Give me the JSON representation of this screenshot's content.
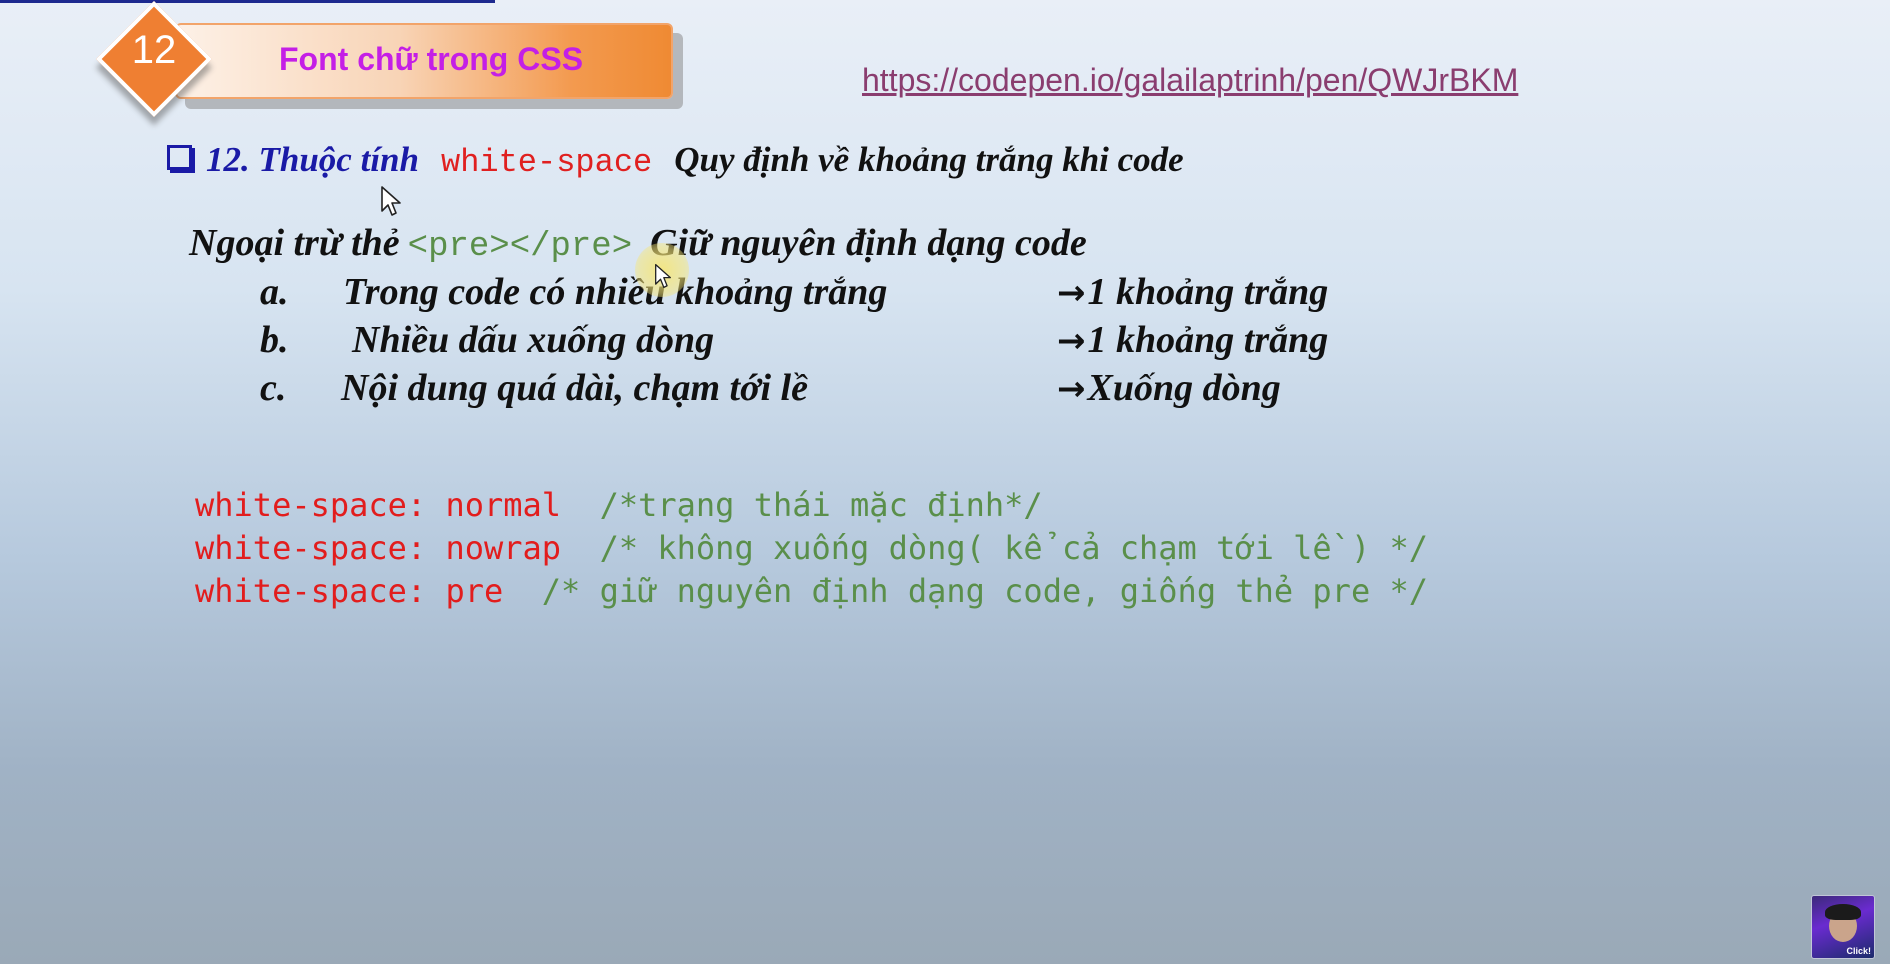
{
  "slide": {
    "badge_number": "12",
    "title": "Font chữ trong CSS",
    "link": "https://codepen.io/galailaptrinh/pen/QWJrBKM"
  },
  "heading": {
    "prefix": "12. Thuộc tính",
    "property": "white-space",
    "description": "Quy định về khoảng trắng khi code"
  },
  "exception": {
    "prefix": "Ngoại trừ thẻ",
    "tag": "<pre></pre>",
    "suffix": "Giữ nguyên định dạng code"
  },
  "rules": [
    {
      "letter": "a.",
      "text": "Trong code có nhiều khoảng trắng",
      "result": "1 khoảng trắng"
    },
    {
      "letter": "b.",
      "text": "Nhiều dấu xuống dòng",
      "result": "1 khoảng trắng"
    },
    {
      "letter": "c.",
      "text": "Nội dung quá dài, chạm tới lề",
      "result": "Xuống dòng"
    }
  ],
  "code_lines": [
    {
      "code": "white-space: normal",
      "comment": "  /*trạng thái mặc định*/"
    },
    {
      "code": "white-space: nowrap",
      "comment": "  /* không xuống dòng( kể cả chạm tới lề ) */"
    },
    {
      "code": "white-space: pre",
      "comment": "  /* giữ nguyên định dạng code, giống thẻ pre */"
    }
  ],
  "avatar": {
    "label": "Click!"
  },
  "colors": {
    "badge": "#ef7f32",
    "title": "#c41fe6",
    "link": "#8a3d6f",
    "heading_blue": "#1a1aa6",
    "code_red": "#e21d1d",
    "code_green": "#5a8f4a"
  }
}
